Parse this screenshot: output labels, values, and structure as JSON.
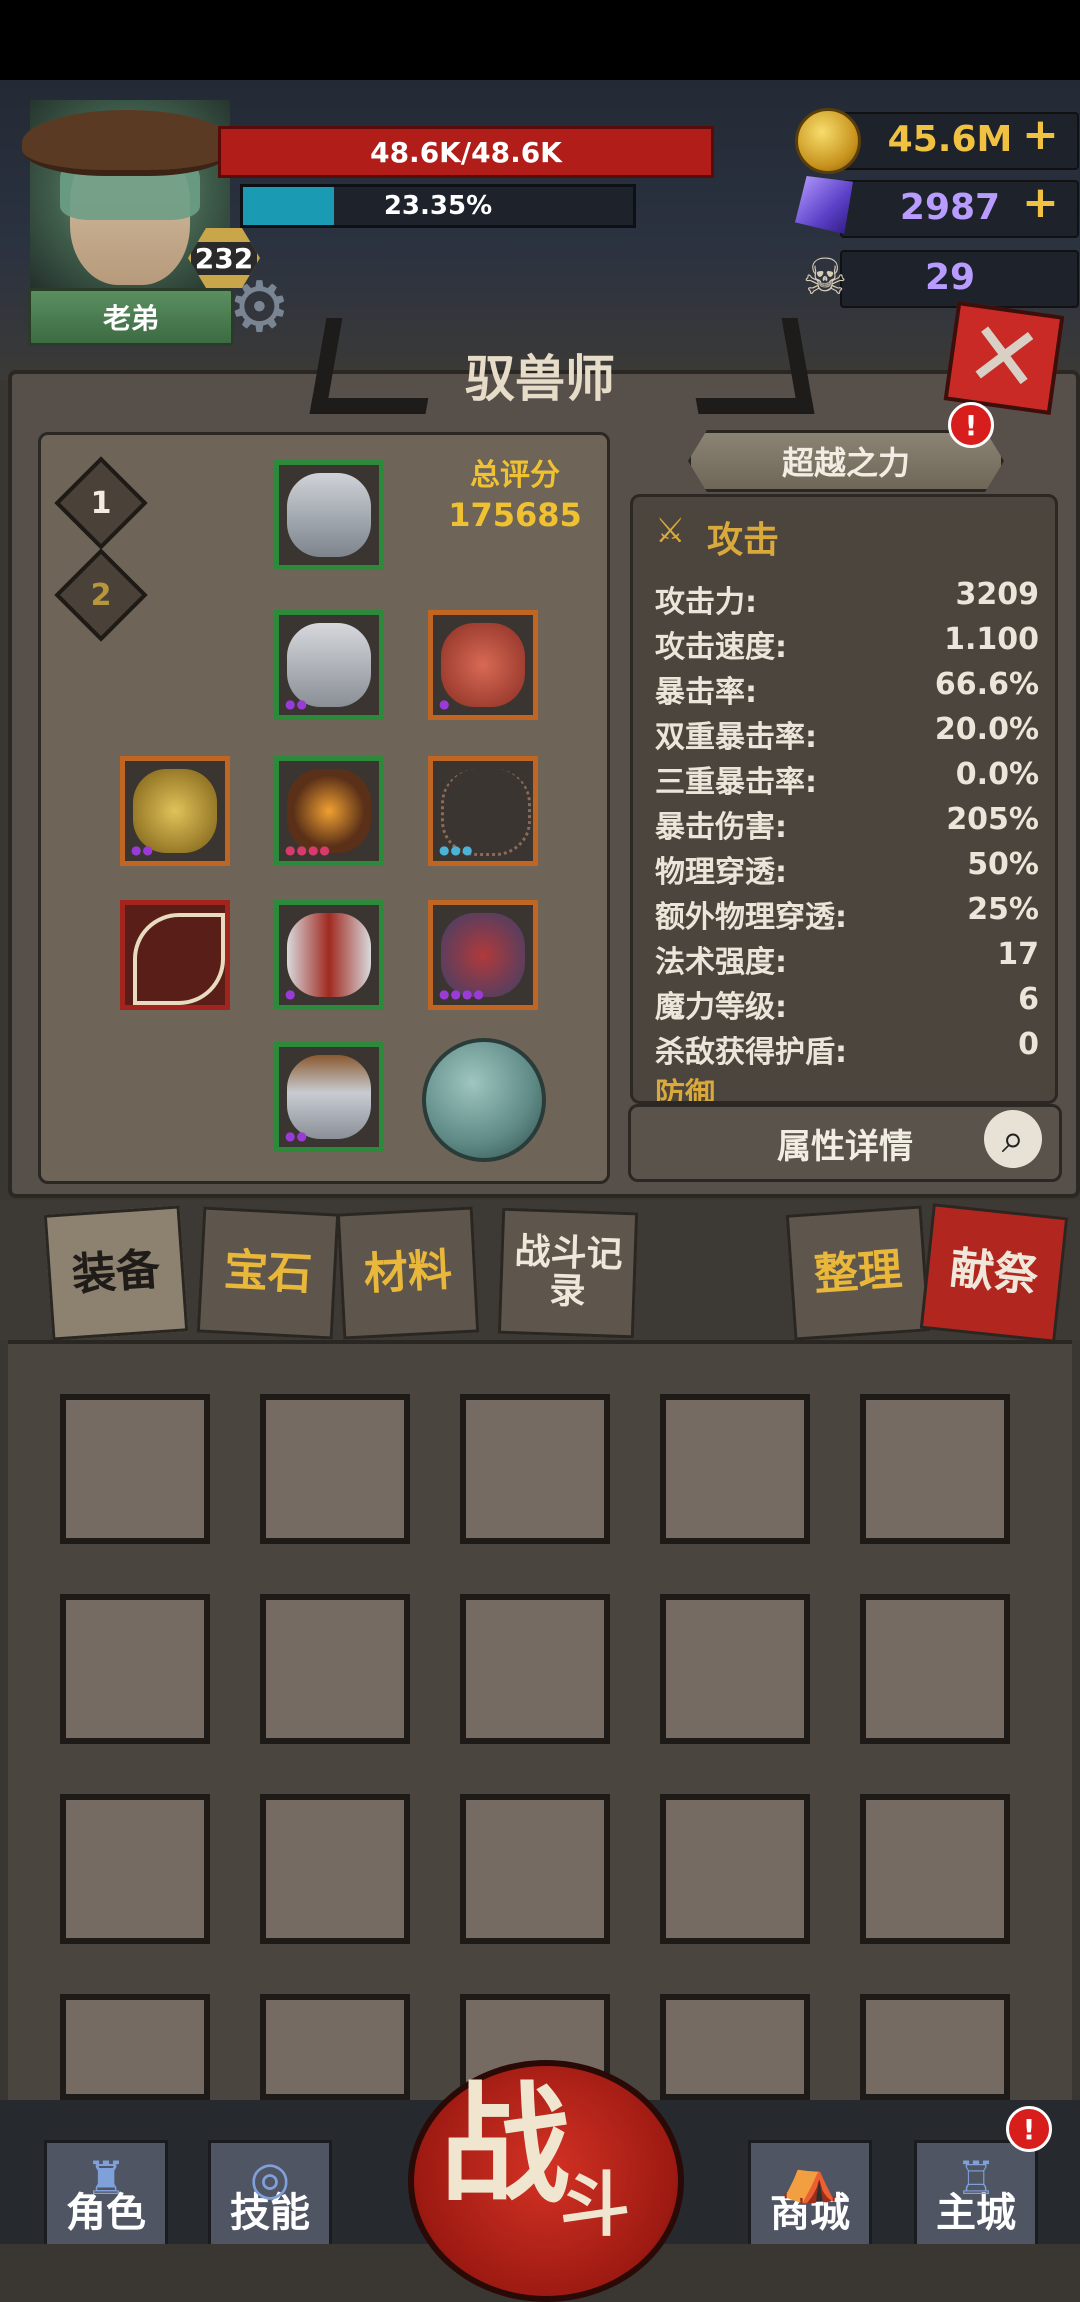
{
  "player": {
    "name": "老弟",
    "level": "232",
    "hp_text": "48.6K/48.6K",
    "xp_text": "23.35%",
    "xp_fraction": 0.2335
  },
  "currencies": {
    "gold": "45.6M",
    "gems": "2987",
    "skulls": "29"
  },
  "panel": {
    "title": "驭兽师",
    "score_label": "总评分",
    "score_value": "175685",
    "set_tabs": [
      "1",
      "2"
    ],
    "beyond_button": "超越之力",
    "details_button": "属性详情"
  },
  "stats": {
    "header": "攻击",
    "rows": [
      {
        "label": "攻击力:",
        "value": "3209"
      },
      {
        "label": "攻击速度:",
        "value": "1.100"
      },
      {
        "label": "暴击率:",
        "value": "66.6%"
      },
      {
        "label": "双重暴击率:",
        "value": "20.0%"
      },
      {
        "label": "三重暴击率:",
        "value": "0.0%"
      },
      {
        "label": "暴击伤害:",
        "value": "205%"
      },
      {
        "label": "物理穿透:",
        "value": "50%"
      },
      {
        "label": "额外物理穿透:",
        "value": "25%"
      },
      {
        "label": "法术强度:",
        "value": "17"
      },
      {
        "label": "魔力等级:",
        "value": "6"
      },
      {
        "label": "杀敌获得护盾:",
        "value": "0"
      }
    ],
    "next_header": "防御"
  },
  "tabs": {
    "equipment": "装备",
    "gems": "宝石",
    "materials": "材料",
    "battle_log": "战斗记录",
    "sort": "整理",
    "sacrifice": "献祭"
  },
  "nav": {
    "character": "角色",
    "skills": "技能",
    "battle": "战斗",
    "shop": "商城",
    "main_city": "主城"
  },
  "alerts": {
    "beyond": "!",
    "main_city": "!"
  },
  "icons": {
    "gold": "gold-coin-icon",
    "gems": "purple-gem-icon",
    "skulls": "ram-skull-icon",
    "close": "close-icon",
    "settings": "gear-icon",
    "search": "magnify-icon"
  },
  "colors": {
    "hp": "#b11e1a",
    "xp": "#1b9bb3",
    "gold_text": "#f1c241",
    "gem_text": "#b89cff",
    "accent_red": "#c92a25"
  }
}
